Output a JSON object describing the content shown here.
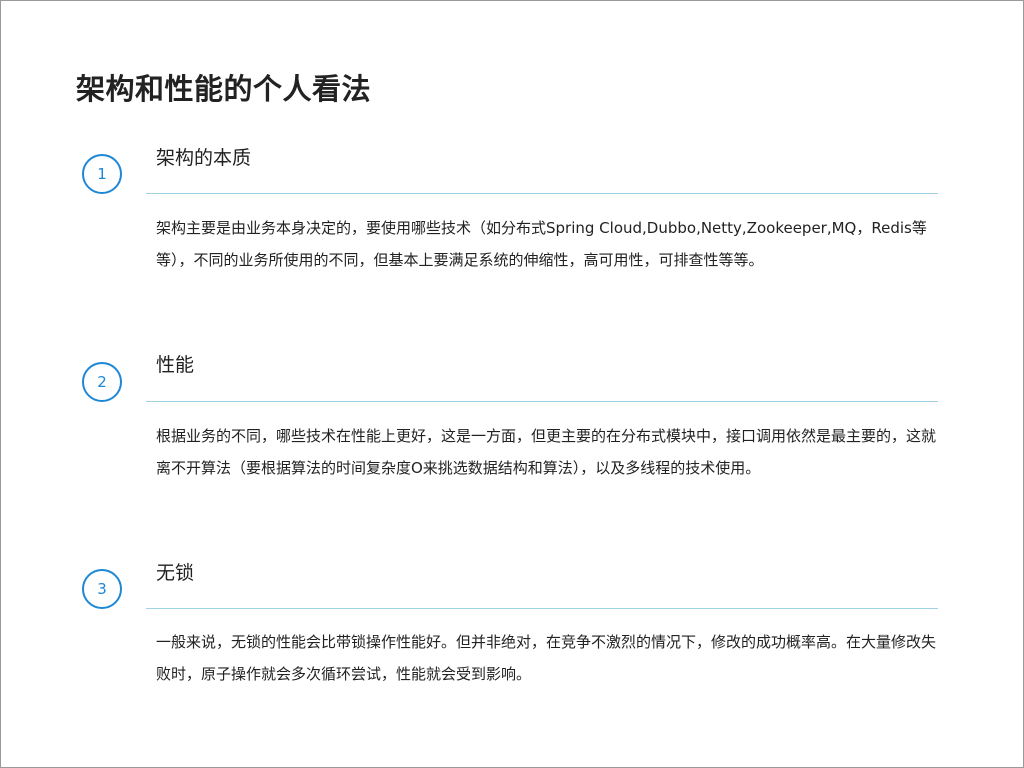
{
  "page": {
    "title": "架构和性能的个人看法"
  },
  "sections": [
    {
      "number": "1",
      "heading": "架构的本质",
      "body": "架构主要是由业务本身决定的，要使用哪些技术（如分布式Spring Cloud,Dubbo,Netty,Zookeeper,MQ，Redis等等），不同的业务所使用的不同，但基本上要满足系统的伸缩性，高可用性，可排查性等等。"
    },
    {
      "number": "2",
      "heading": "性能",
      "body": "根据业务的不同，哪些技术在性能上更好，这是一方面，但更主要的在分布式模块中，接口调用依然是最主要的，这就离不开算法（要根据算法的时间复杂度O来挑选数据结构和算法），以及多线程的技术使用。"
    },
    {
      "number": "3",
      "heading": "无锁",
      "body": "一般来说，无锁的性能会比带锁操作性能好。但并非绝对，在竞争不激烈的情况下，修改的成功概率高。在大量修改失败时，原子操作就会多次循环尝试，性能就会受到影响。"
    }
  ],
  "colors": {
    "accent": "#1e88d6",
    "divider": "#9fd2e2",
    "text": "#222222"
  }
}
